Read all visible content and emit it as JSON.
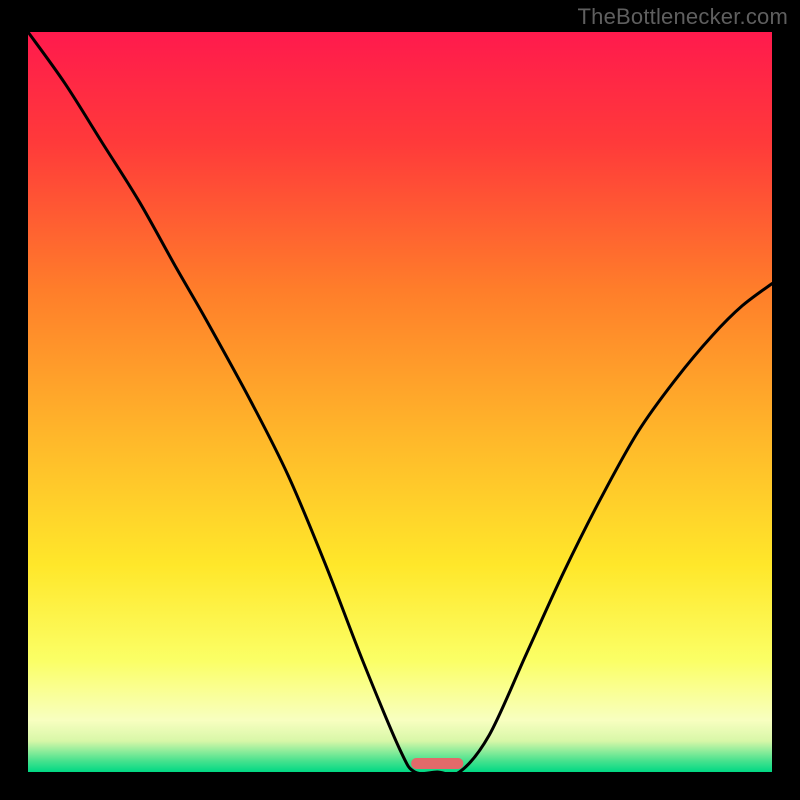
{
  "attribution": "TheBottlenecker.com",
  "chart_data": {
    "type": "line",
    "title": "",
    "xlabel": "",
    "ylabel": "",
    "x": [
      0.0,
      0.05,
      0.1,
      0.15,
      0.2,
      0.24,
      0.3,
      0.35,
      0.4,
      0.45,
      0.5,
      0.52,
      0.55,
      0.58,
      0.62,
      0.67,
      0.72,
      0.77,
      0.82,
      0.87,
      0.92,
      0.96,
      1.0
    ],
    "values": [
      1.0,
      0.93,
      0.85,
      0.77,
      0.68,
      0.61,
      0.5,
      0.4,
      0.28,
      0.15,
      0.03,
      0.0,
      0.0,
      0.0,
      0.05,
      0.16,
      0.27,
      0.37,
      0.46,
      0.53,
      0.59,
      0.63,
      0.66
    ],
    "ylim": [
      0,
      1
    ],
    "xlim": [
      0,
      1
    ],
    "marker": {
      "x": 0.55,
      "width_frac": 0.07
    },
    "gradient_stops": [
      {
        "offset": 0.0,
        "color": "#ff1a4d"
      },
      {
        "offset": 0.15,
        "color": "#ff3a3a"
      },
      {
        "offset": 0.35,
        "color": "#ff7e2a"
      },
      {
        "offset": 0.55,
        "color": "#ffb82a"
      },
      {
        "offset": 0.72,
        "color": "#ffe72a"
      },
      {
        "offset": 0.85,
        "color": "#fbff66"
      },
      {
        "offset": 0.93,
        "color": "#f8ffc0"
      },
      {
        "offset": 0.958,
        "color": "#d8f7a8"
      },
      {
        "offset": 0.985,
        "color": "#47e28e"
      },
      {
        "offset": 1.0,
        "color": "#00d884"
      }
    ]
  }
}
